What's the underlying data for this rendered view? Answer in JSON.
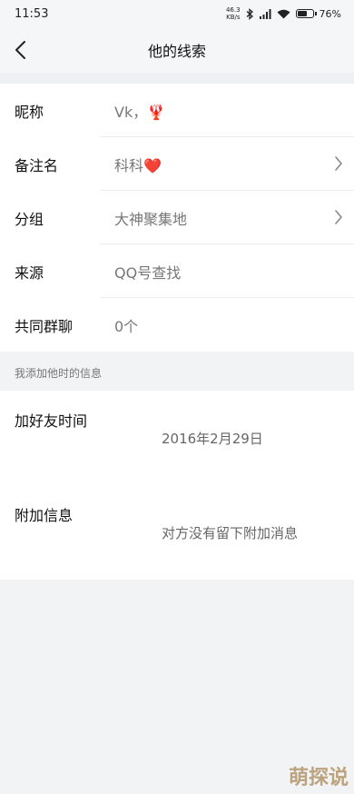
{
  "status_bar": {
    "time": "11:53",
    "net_speed_top": "46.3",
    "net_speed_bottom": "KB/s",
    "battery": "76",
    "battery_level": 0.76
  },
  "nav": {
    "title": "他的线索"
  },
  "profile_rows": [
    {
      "label": "昵称",
      "value": "Vk，🦞"
    },
    {
      "label": "备注名",
      "value": "科科❤️"
    },
    {
      "label": "分组",
      "value": "大神聚集地"
    },
    {
      "label": "来源",
      "value": "QQ号查找"
    },
    {
      "label": "共同群聊",
      "value": "0个"
    }
  ],
  "section_header": "我添加他时的信息",
  "add_info": {
    "time_label": "加好友时间",
    "time_value": "2016年2月29日",
    "message_label": "附加信息",
    "message_value": "对方没有留下附加消息"
  },
  "watermark": "萌探说"
}
